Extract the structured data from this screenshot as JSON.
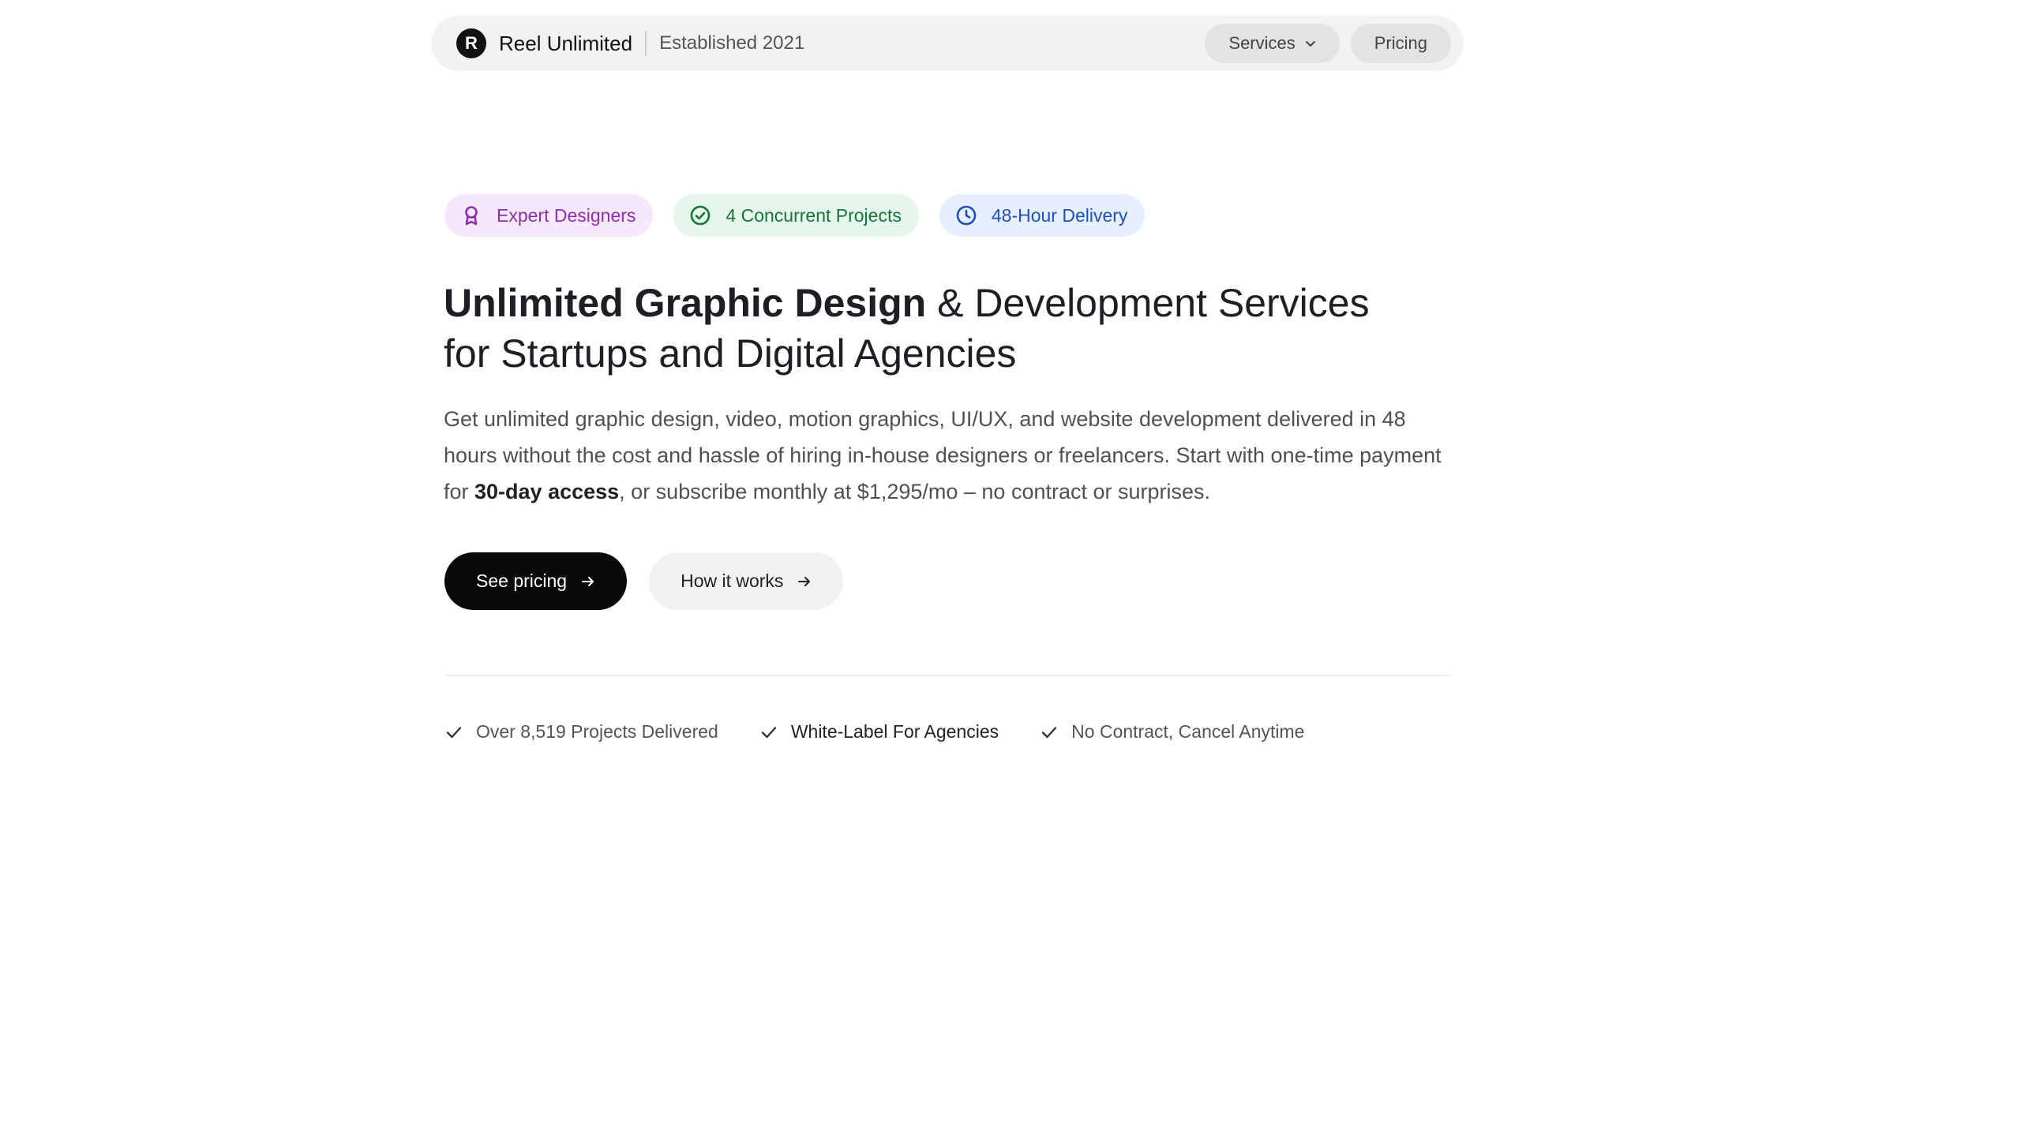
{
  "nav": {
    "logo_letter": "R",
    "brand_name": "Reel Unlimited",
    "established": "Established 2021",
    "services_label": "Services",
    "pricing_label": "Pricing"
  },
  "badges": [
    {
      "label": "Expert Designers",
      "icon": "award-icon",
      "color": "#8f2fb0"
    },
    {
      "label": "4 Concurrent Projects",
      "icon": "check-circle-icon",
      "color": "#17743b"
    },
    {
      "label": "48-Hour Delivery",
      "icon": "clock-icon",
      "color": "#1f4fb9"
    }
  ],
  "hero": {
    "headline_strong": "Unlimited Graphic Design",
    "headline_rest": " & Development Services for Startups and Digital Agencies",
    "desc_part1": "Get unlimited graphic design, video, motion graphics, UI/UX, and website development delivered in 48 hours without the cost and hassle of hiring in-house designers or freelancers. Start with one-time payment for ",
    "desc_bold": "30-day access",
    "desc_part2": ", or subscribe monthly at $1,295/mo – no contract or surprises."
  },
  "ctas": {
    "primary": "See pricing",
    "secondary": "How it works"
  },
  "features": [
    "Over 8,519 Projects Delivered",
    "White-Label For Agencies",
    "No Contract, Cancel Anytime"
  ]
}
